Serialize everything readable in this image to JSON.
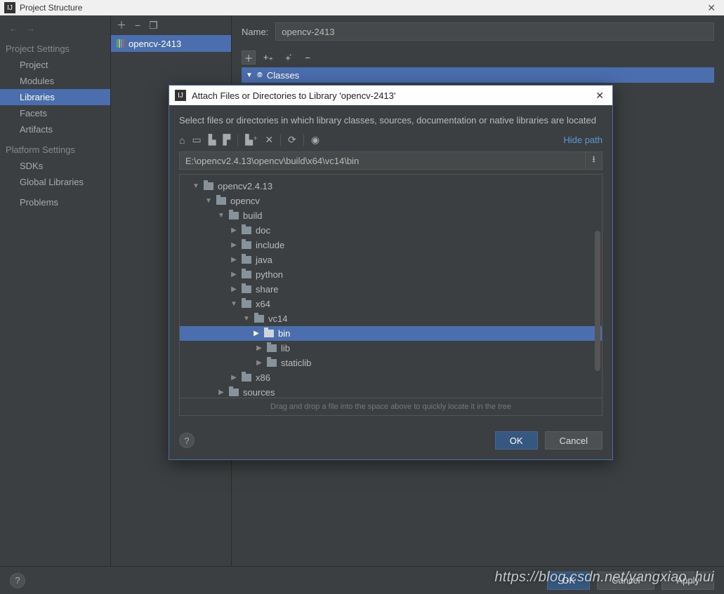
{
  "window": {
    "title": "Project Structure"
  },
  "sidebar": {
    "project_settings_label": "Project Settings",
    "platform_settings_label": "Platform Settings",
    "items": {
      "project": "Project",
      "modules": "Modules",
      "libraries": "Libraries",
      "facets": "Facets",
      "artifacts": "Artifacts",
      "sdks": "SDKs",
      "global_libraries": "Global Libraries"
    },
    "problems": "Problems"
  },
  "libraries_list": {
    "items": [
      "opencv-2413"
    ]
  },
  "detail": {
    "name_label": "Name:",
    "name_value": "opencv-2413",
    "classes_label": "Classes"
  },
  "modal": {
    "title": "Attach Files or Directories to Library 'opencv-2413'",
    "message": "Select files or directories in which library classes, sources, documentation or native libraries are located",
    "hide_path": "Hide path",
    "path_value": "E:\\opencv2.4.13\\opencv\\build\\x64\\vc14\\bin",
    "tree": [
      {
        "depth": 0,
        "arrow": "down",
        "label": "opencv2.4.13",
        "sel": false
      },
      {
        "depth": 1,
        "arrow": "down",
        "label": "opencv",
        "sel": false
      },
      {
        "depth": 2,
        "arrow": "down",
        "label": "build",
        "sel": false
      },
      {
        "depth": 3,
        "arrow": "right",
        "label": "doc",
        "sel": false
      },
      {
        "depth": 3,
        "arrow": "right",
        "label": "include",
        "sel": false
      },
      {
        "depth": 3,
        "arrow": "right",
        "label": "java",
        "sel": false
      },
      {
        "depth": 3,
        "arrow": "right",
        "label": "python",
        "sel": false
      },
      {
        "depth": 3,
        "arrow": "right",
        "label": "share",
        "sel": false
      },
      {
        "depth": 3,
        "arrow": "down",
        "label": "x64",
        "sel": false
      },
      {
        "depth": 4,
        "arrow": "down",
        "label": "vc14",
        "sel": false
      },
      {
        "depth": 5,
        "arrow": "right",
        "label": "bin",
        "sel": true
      },
      {
        "depth": 5,
        "arrow": "right",
        "label": "lib",
        "sel": false
      },
      {
        "depth": 5,
        "arrow": "right",
        "label": "staticlib",
        "sel": false
      },
      {
        "depth": 3,
        "arrow": "right",
        "label": "x86",
        "sel": false
      },
      {
        "depth": 2,
        "arrow": "right",
        "label": "sources",
        "sel": false
      }
    ],
    "drag_hint": "Drag and drop a file into the space above to quickly locate it in the tree",
    "ok_label": "OK",
    "cancel_label": "Cancel"
  },
  "bottom": {
    "ok_label": "OK",
    "cancel_label": "Cancel",
    "apply_label": "Apply"
  },
  "watermark": "https://blog.csdn.net/yangxiao_hui"
}
